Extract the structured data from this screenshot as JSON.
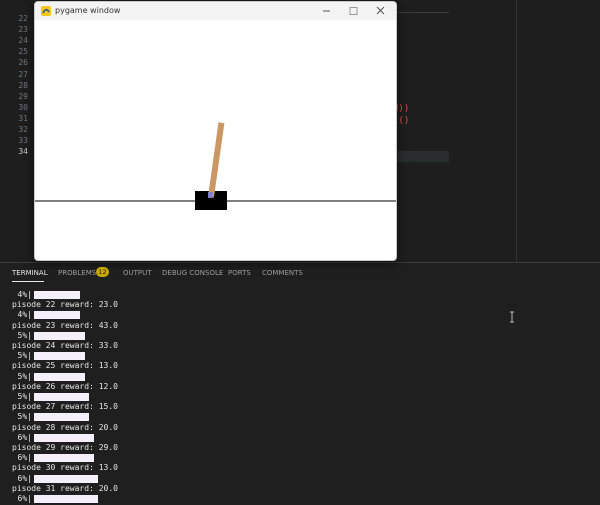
{
  "editor": {
    "line_numbers": [
      "22",
      "23",
      "24",
      "25",
      "26",
      "27",
      "28",
      "29",
      "30",
      "31",
      "32",
      "33",
      "34"
    ],
    "current_line": "34",
    "fragments": [
      {
        "text": "d))",
        "color": "#f14c4c"
      },
      {
        "text": "t()",
        "color": "#f14c4c"
      }
    ]
  },
  "pygame_window": {
    "title": "pygame window",
    "icon": "pygame-snake-icon",
    "buttons": {
      "minimize": "minimize-icon",
      "maximize": "maximize-icon",
      "close": "close-icon"
    },
    "scene": {
      "track_color": "#000000",
      "cart_color": "#000000",
      "pole_color": "#ca9865",
      "axle_color": "#8184cb",
      "pole_angle_deg": 8
    }
  },
  "panel": {
    "tabs": [
      {
        "label": "TERMINAL",
        "active": true
      },
      {
        "label": "PROBLEMS",
        "active": false
      },
      {
        "label": "OUTPUT",
        "active": false
      },
      {
        "label": "DEBUG CONSOLE",
        "active": false
      },
      {
        "label": "PORTS",
        "active": false
      },
      {
        "label": "COMMENTS",
        "active": false
      }
    ],
    "problems_count": "12"
  },
  "terminal": {
    "lines": [
      {
        "kind": "progress",
        "pct": "4%|",
        "fill": 0.2
      },
      {
        "kind": "text",
        "text": "pisode 22 reward: 23.0"
      },
      {
        "kind": "progress",
        "pct": "4%|",
        "fill": 0.2
      },
      {
        "kind": "text",
        "text": "pisode 23 reward: 43.0"
      },
      {
        "kind": "progress",
        "pct": "5%|",
        "fill": 0.22
      },
      {
        "kind": "text",
        "text": "pisode 24 reward: 33.0"
      },
      {
        "kind": "progress",
        "pct": "5%|",
        "fill": 0.22
      },
      {
        "kind": "text",
        "text": "pisode 25 reward: 13.0"
      },
      {
        "kind": "progress",
        "pct": "5%|",
        "fill": 0.22
      },
      {
        "kind": "text",
        "text": "pisode 26 reward: 12.0"
      },
      {
        "kind": "progress",
        "pct": "5%|",
        "fill": 0.24
      },
      {
        "kind": "text",
        "text": "pisode 27 reward: 15.0"
      },
      {
        "kind": "progress",
        "pct": "5%|",
        "fill": 0.24
      },
      {
        "kind": "text",
        "text": "pisode 28 reward: 20.0"
      },
      {
        "kind": "progress",
        "pct": "6%|",
        "fill": 0.26
      },
      {
        "kind": "text",
        "text": "pisode 29 reward: 29.0"
      },
      {
        "kind": "progress",
        "pct": "6%|",
        "fill": 0.26
      },
      {
        "kind": "text",
        "text": "pisode 30 reward: 13.0"
      },
      {
        "kind": "progress",
        "pct": "6%|",
        "fill": 0.28
      },
      {
        "kind": "text",
        "text": "pisode 31 reward: 20.0"
      },
      {
        "kind": "progress",
        "pct": "6%|",
        "fill": 0.28
      }
    ]
  }
}
